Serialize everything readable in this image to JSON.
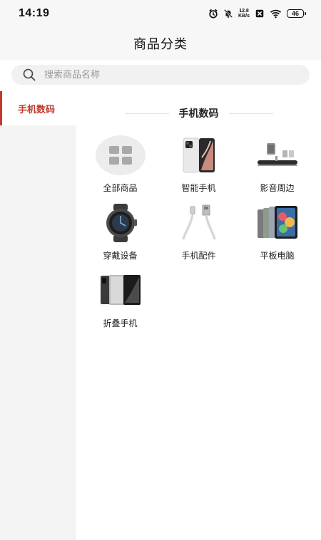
{
  "status_bar": {
    "time": "14:19",
    "net_speed_value": "12.8",
    "net_speed_unit": "KB/s",
    "battery": "46"
  },
  "header": {
    "title": "商品分类"
  },
  "search": {
    "placeholder": "搜索商品名称",
    "value": ""
  },
  "sidebar": {
    "items": [
      {
        "label": "手机数码",
        "selected": true
      }
    ]
  },
  "section": {
    "title": "手机数码"
  },
  "categories": [
    {
      "label": "全部商品",
      "icon": "grid-icon"
    },
    {
      "label": "智能手机",
      "icon": "smartphone-image"
    },
    {
      "label": "影音周边",
      "icon": "speaker-image"
    },
    {
      "label": "穿戴设备",
      "icon": "smartwatch-image"
    },
    {
      "label": "手机配件",
      "icon": "usb-cable-image"
    },
    {
      "label": "平板电脑",
      "icon": "tablet-image"
    },
    {
      "label": "折叠手机",
      "icon": "foldable-phone-image"
    }
  ],
  "colors": {
    "accent": "#c0392b",
    "page_bg": "#f7f7f7",
    "panel_bg": "#ffffff"
  }
}
